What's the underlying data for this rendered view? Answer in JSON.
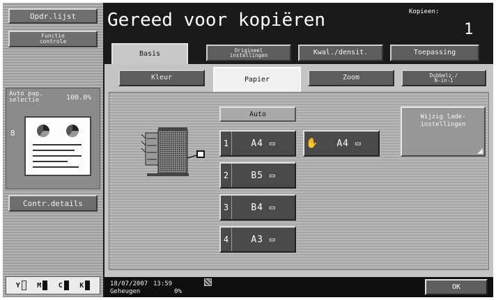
{
  "left": {
    "job_list_label": "Opdr.lijst",
    "function_line1": "Functie",
    "function_line2": "controle",
    "auto_paper_line1": "Auto pap.",
    "auto_paper_line2": "selectie",
    "zoom_value": "100.0%",
    "original_count": "8",
    "check_details_label": "Contr.details",
    "ymck": [
      "Y",
      "M",
      "C",
      "K"
    ]
  },
  "header": {
    "title": "Gereed voor kopiëren",
    "copies_label": "Kopieen:",
    "copies_value": "1"
  },
  "tabs": [
    {
      "line1": "Basis",
      "line2": ""
    },
    {
      "line1": "Origineel",
      "line2": "instellingen"
    },
    {
      "line1": "Kwal./densit.",
      "line2": ""
    },
    {
      "line1": "Toepassing",
      "line2": ""
    }
  ],
  "subtabs": [
    {
      "line1": "Kleur",
      "line2": ""
    },
    {
      "line1": "Papier",
      "line2": ""
    },
    {
      "line1": "Zoom",
      "line2": ""
    },
    {
      "line1": "Dubbelz./",
      "line2": "N-in-1"
    }
  ],
  "paper": {
    "auto_label": "Auto",
    "trays": [
      {
        "num": "1",
        "size": "A4 ▭"
      },
      {
        "num": "2",
        "size": "B5 ▭"
      },
      {
        "num": "3",
        "size": "B4 ▭"
      },
      {
        "num": "4",
        "size": "A3 ▭"
      }
    ],
    "manual_size": "A4 ▭",
    "change_tray_line1": "Wijzig lade-",
    "change_tray_line2": "instellingen"
  },
  "footer": {
    "date": "18/07/2007",
    "time": "13:59",
    "memory_label": "Geheugen",
    "memory_value": "0%",
    "ok_label": "OK"
  }
}
